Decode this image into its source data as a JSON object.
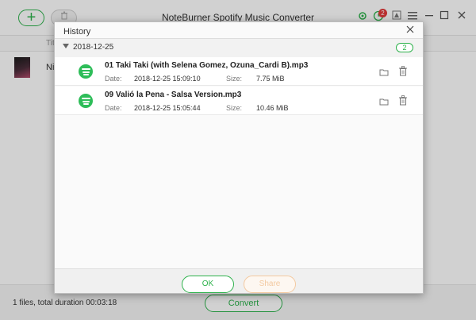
{
  "app": {
    "title": "NoteBurner Spotify Music Converter",
    "add_icon": "+",
    "delete_icon": "trash-icon",
    "notification_count": "2"
  },
  "list": {
    "column_title": "Tit",
    "row": {
      "name": "Ni"
    }
  },
  "footer": {
    "summary": "1 files, total duration 00:03:18",
    "convert_label": "Convert"
  },
  "dialog": {
    "title": "History",
    "close_icon": "close-icon",
    "group": {
      "date": "2018-12-25",
      "count": "2"
    },
    "items": [
      {
        "filename": "01 Taki Taki (with Selena Gomez, Ozuna_Cardi B).mp3",
        "date_label": "Date:",
        "date": "2018-12-25 15:09:10",
        "size_label": "Size:",
        "size": "7.75 MiB"
      },
      {
        "filename": "09 Valió la Pena - Salsa Version.mp3",
        "date_label": "Date:",
        "date": "2018-12-25 15:05:44",
        "size_label": "Size:",
        "size": "10.46 MiB"
      }
    ],
    "ok_label": "OK",
    "share_label": "Share"
  },
  "colors": {
    "accent": "#2eb24c",
    "spotify": "#2ebd59",
    "share_disabled": "#f3c9a0"
  }
}
